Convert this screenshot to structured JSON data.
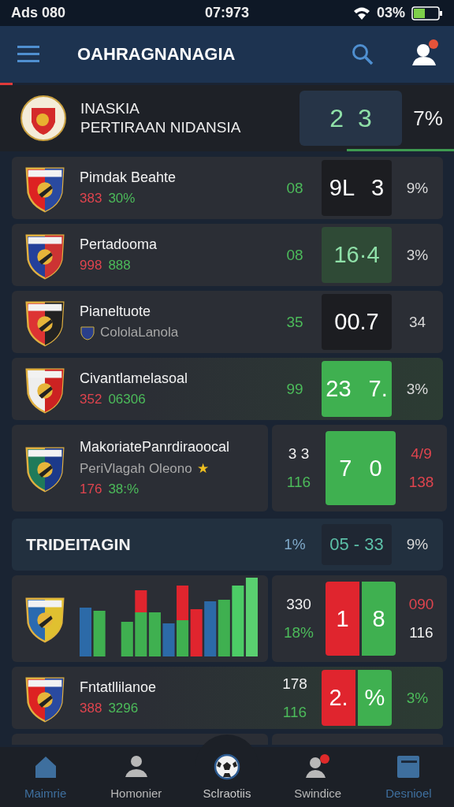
{
  "status_bar": {
    "left": "Ads 080",
    "time": "07:973",
    "battery": "03%"
  },
  "app_bar": {
    "title": "OAHRAGNANAGIA",
    "notification": true
  },
  "featured": {
    "name_lines": [
      "INASKIA",
      "PERTIRAAN NIDANSIA"
    ],
    "score": [
      {
        "text": "2",
        "kind": "slate"
      },
      {
        "text": "3",
        "kind": "slate"
      }
    ],
    "pct": "7%"
  },
  "rows": [
    {
      "kind": "full",
      "highlighted": false,
      "name": "Pimdak Beahte",
      "stats": [
        {
          "text": "383",
          "color": "#e0444e"
        },
        {
          "text": "30%",
          "color": "#4cbb5a"
        }
      ],
      "left_nums": [
        {
          "text": "08",
          "color": "#4cbb5a"
        }
      ],
      "score": [
        {
          "text": "9L 3",
          "kind": "dark"
        }
      ],
      "right_nums": [
        {
          "text": "9%",
          "color": "#d8d8d8"
        }
      ]
    },
    {
      "kind": "full",
      "highlighted": false,
      "name": "Pertadooma",
      "stats": [
        {
          "text": "998",
          "color": "#e0444e"
        },
        {
          "text": "888",
          "color": "#4cbb5a"
        }
      ],
      "left_nums": [
        {
          "text": "08",
          "color": "#4cbb5a"
        }
      ],
      "score": [
        {
          "text": "16·4",
          "kind": "dim"
        }
      ],
      "right_nums": [
        {
          "text": "3%",
          "color": "#d8d8d8"
        }
      ]
    },
    {
      "kind": "full",
      "highlighted": false,
      "name": "Pianeltuote",
      "subtitle": "CololaLanola",
      "left_nums": [
        {
          "text": "35",
          "color": "#4cbb5a"
        }
      ],
      "score": [
        {
          "text": "00.7",
          "kind": "dark"
        }
      ],
      "right_nums": [
        {
          "text": "34",
          "color": "#d8d8d8"
        }
      ]
    },
    {
      "kind": "full",
      "highlighted": true,
      "name": "Civantlamelasoal",
      "stats": [
        {
          "text": "352",
          "color": "#e0444e"
        },
        {
          "text": "06306",
          "color": "#4cbb5a"
        }
      ],
      "left_nums": [
        {
          "text": "99",
          "color": "#4cbb5a"
        }
      ],
      "score": [
        {
          "text": "23 7.",
          "kind": "green"
        }
      ],
      "right_nums": [
        {
          "text": "3%",
          "color": "#d8d8d8"
        }
      ]
    },
    {
      "kind": "split",
      "highlighted": false,
      "name": "MakoriatePanrdiraoocal",
      "subtitle": "PeriVlagah Oleono",
      "star": "★",
      "stats": [
        {
          "text": "176",
          "color": "#e0444e"
        },
        {
          "text": "38:%",
          "color": "#4cbb5a"
        }
      ],
      "left_nums": [
        {
          "text": "3 3",
          "color": "#f0f0f0"
        },
        {
          "text": "116",
          "color": "#4cbb5a"
        }
      ],
      "score": [
        {
          "text": "7 0",
          "kind": "green"
        }
      ],
      "right_nums": [
        {
          "text": "4/9",
          "color": "#e0444e"
        },
        {
          "text": "138",
          "color": "#e0444e"
        }
      ]
    },
    {
      "kind": "section",
      "name": "TRIDEITAGIN",
      "left_nums": [
        {
          "text": "1%",
          "color": "#7fa8c8"
        }
      ],
      "score": [
        {
          "text": "05 - 33",
          "kind": "teal"
        }
      ],
      "right_nums": [
        {
          "text": "9%",
          "color": "#d8d8d8"
        }
      ]
    },
    {
      "kind": "chart",
      "highlighted": false,
      "left_nums": [
        {
          "text": "330",
          "color": "#f0f0f0"
        },
        {
          "text": "18%",
          "color": "#4cbb5a"
        }
      ],
      "score": [
        {
          "text": "1",
          "kind": "red"
        },
        {
          "text": "8",
          "kind": "green"
        }
      ],
      "right_nums": [
        {
          "text": "090",
          "color": "#e0444e"
        },
        {
          "text": "116",
          "color": "#f0f0f0"
        }
      ]
    },
    {
      "kind": "full",
      "highlighted": true,
      "name": "Fntatllilanoe",
      "stats": [
        {
          "text": "388",
          "color": "#e0444e"
        },
        {
          "text": "3296",
          "color": "#4cbb5a"
        }
      ],
      "left_nums": [
        {
          "text": "178",
          "color": "#f0f0f0"
        },
        {
          "text": "116",
          "color": "#4cbb5a"
        }
      ],
      "score": [
        {
          "text": "2.",
          "kind": "red"
        },
        {
          "text": "%",
          "kind": "green"
        }
      ],
      "right_nums": [
        {
          "text": "3%",
          "color": "#4cbb5a"
        }
      ]
    }
  ],
  "nav": [
    {
      "label": "Maimrie",
      "color": "#3e6f9e"
    },
    {
      "label": "Homonier",
      "color": "#b8b8b8"
    },
    {
      "label": "Sclraotiis",
      "color": "#c8c8c8"
    },
    {
      "label": "Swindice",
      "color": "#b8b8b8"
    },
    {
      "label": "Desnioel",
      "color": "#3e6f9e"
    }
  ]
}
